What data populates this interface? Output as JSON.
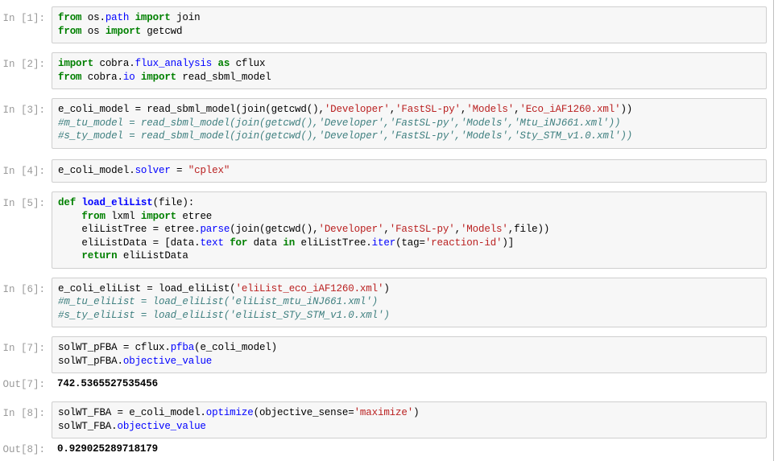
{
  "notebook": {
    "cells": [
      {
        "type": "input",
        "prompt": "In [1]:",
        "name": "cell-in-1",
        "lines": [
          [
            {
              "t": "from ",
              "c": "k"
            },
            {
              "t": "os.",
              "c": "n"
            },
            {
              "t": "path",
              "c": "nn"
            },
            {
              "t": " import ",
              "c": "k"
            },
            {
              "t": "join",
              "c": "n"
            }
          ],
          [
            {
              "t": "from ",
              "c": "k"
            },
            {
              "t": "os",
              "c": "n"
            },
            {
              "t": " import ",
              "c": "k"
            },
            {
              "t": "getcwd",
              "c": "n"
            }
          ]
        ]
      },
      {
        "type": "input",
        "prompt": "In [2]:",
        "name": "cell-in-2",
        "lines": [
          [
            {
              "t": "import ",
              "c": "k"
            },
            {
              "t": "cobra.",
              "c": "n"
            },
            {
              "t": "flux_analysis",
              "c": "nn"
            },
            {
              "t": " as ",
              "c": "k"
            },
            {
              "t": "cflux",
              "c": "n"
            }
          ],
          [
            {
              "t": "from ",
              "c": "k"
            },
            {
              "t": "cobra.",
              "c": "n"
            },
            {
              "t": "io",
              "c": "nn"
            },
            {
              "t": " import ",
              "c": "k"
            },
            {
              "t": "read_sbml_model",
              "c": "n"
            }
          ]
        ]
      },
      {
        "type": "input",
        "prompt": "In [3]:",
        "name": "cell-in-3",
        "lines": [
          [
            {
              "t": "e_coli_model = read_sbml_model(join(getcwd(),",
              "c": "n"
            },
            {
              "t": "'Developer'",
              "c": "s"
            },
            {
              "t": ",",
              "c": "n"
            },
            {
              "t": "'FastSL-py'",
              "c": "s"
            },
            {
              "t": ",",
              "c": "n"
            },
            {
              "t": "'Models'",
              "c": "s"
            },
            {
              "t": ",",
              "c": "n"
            },
            {
              "t": "'Eco_iAF1260.xml'",
              "c": "s"
            },
            {
              "t": "))",
              "c": "n"
            }
          ],
          [
            {
              "t": "#m_tu_model = read_sbml_model(join(getcwd(),'Developer','FastSL-py','Models','Mtu_iNJ661.xml'))",
              "c": "c"
            }
          ],
          [
            {
              "t": "#s_ty_model = read_sbml_model(join(getcwd(),'Developer','FastSL-py','Models','Sty_STM_v1.0.xml'))",
              "c": "c"
            }
          ]
        ]
      },
      {
        "type": "input",
        "prompt": "In [4]:",
        "name": "cell-in-4",
        "lines": [
          [
            {
              "t": "e_coli_model.",
              "c": "n"
            },
            {
              "t": "solver",
              "c": "nb"
            },
            {
              "t": " = ",
              "c": "n"
            },
            {
              "t": "\"cplex\"",
              "c": "s"
            }
          ]
        ]
      },
      {
        "type": "input",
        "prompt": "In [5]:",
        "name": "cell-in-5",
        "lines": [
          [
            {
              "t": "def ",
              "c": "k"
            },
            {
              "t": "load_eliList",
              "c": "nf"
            },
            {
              "t": "(file):",
              "c": "n"
            }
          ],
          [
            {
              "t": "    ",
              "c": "n"
            },
            {
              "t": "from ",
              "c": "k"
            },
            {
              "t": "lxml",
              "c": "n"
            },
            {
              "t": " import ",
              "c": "k"
            },
            {
              "t": "etree",
              "c": "n"
            }
          ],
          [
            {
              "t": "    eliListTree = etree.",
              "c": "n"
            },
            {
              "t": "parse",
              "c": "nb"
            },
            {
              "t": "(join(getcwd(),",
              "c": "n"
            },
            {
              "t": "'Developer'",
              "c": "s"
            },
            {
              "t": ",",
              "c": "n"
            },
            {
              "t": "'FastSL-py'",
              "c": "s"
            },
            {
              "t": ",",
              "c": "n"
            },
            {
              "t": "'Models'",
              "c": "s"
            },
            {
              "t": ",file))",
              "c": "n"
            }
          ],
          [
            {
              "t": "    eliListData = [data.",
              "c": "n"
            },
            {
              "t": "text",
              "c": "nb"
            },
            {
              "t": " for ",
              "c": "k"
            },
            {
              "t": "data ",
              "c": "n"
            },
            {
              "t": "in ",
              "c": "k"
            },
            {
              "t": "eliListTree.",
              "c": "n"
            },
            {
              "t": "iter",
              "c": "nb"
            },
            {
              "t": "(tag=",
              "c": "n"
            },
            {
              "t": "'reaction-id'",
              "c": "s"
            },
            {
              "t": ")]",
              "c": "n"
            }
          ],
          [
            {
              "t": "    ",
              "c": "n"
            },
            {
              "t": "return ",
              "c": "k"
            },
            {
              "t": "eliListData",
              "c": "n"
            }
          ]
        ]
      },
      {
        "type": "input",
        "prompt": "In [6]:",
        "name": "cell-in-6",
        "lines": [
          [
            {
              "t": "e_coli_eliList = load_eliList(",
              "c": "n"
            },
            {
              "t": "'eliList_eco_iAF1260.xml'",
              "c": "s"
            },
            {
              "t": ")",
              "c": "n"
            }
          ],
          [
            {
              "t": "#m_tu_eliList = load_eliList('eliList_mtu_iNJ661.xml')",
              "c": "c"
            }
          ],
          [
            {
              "t": "#s_ty_eliList = load_eliList('eliList_STy_STM_v1.0.xml')",
              "c": "c"
            }
          ]
        ]
      },
      {
        "type": "input",
        "prompt": "In [7]:",
        "name": "cell-in-7",
        "lines": [
          [
            {
              "t": "solWT_pFBA = cflux.",
              "c": "n"
            },
            {
              "t": "pfba",
              "c": "nb"
            },
            {
              "t": "(e_coli_model)",
              "c": "n"
            }
          ],
          [
            {
              "t": "solWT_pFBA.",
              "c": "n"
            },
            {
              "t": "objective_value",
              "c": "nb"
            }
          ]
        ]
      },
      {
        "type": "output",
        "prompt": "Out[7]:",
        "name": "cell-out-7",
        "text": "742.5365527535456"
      },
      {
        "type": "input",
        "prompt": "In [8]:",
        "name": "cell-in-8",
        "lines": [
          [
            {
              "t": "solWT_FBA = e_coli_model.",
              "c": "n"
            },
            {
              "t": "optimize",
              "c": "nb"
            },
            {
              "t": "(objective_sense=",
              "c": "n"
            },
            {
              "t": "'maximize'",
              "c": "s"
            },
            {
              "t": ")",
              "c": "n"
            }
          ],
          [
            {
              "t": "solWT_FBA.",
              "c": "n"
            },
            {
              "t": "objective_value",
              "c": "nb"
            }
          ]
        ]
      },
      {
        "type": "output",
        "prompt": "Out[8]:",
        "name": "cell-out-8",
        "text": "0.929025289718179"
      }
    ]
  },
  "colors": {
    "keyword": "#008000",
    "string": "#ba2121",
    "comment": "#408080",
    "name_builtin": "#0000ff",
    "prompt": "#9a9a9a",
    "cell_background": "#f7f7f7",
    "cell_border": "#cfcfcf",
    "page_background": "#ffffff"
  }
}
